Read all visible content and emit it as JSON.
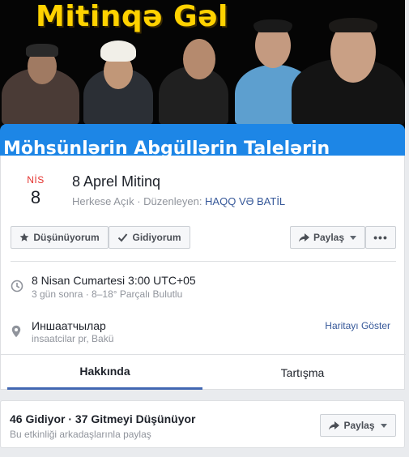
{
  "cover": {
    "title": "Mitinqə Gəl",
    "banner_text": "Möhsünlərin Abgüllərin Talelərin",
    "title_color": "#ffd200",
    "banner_color": "#1d86e6"
  },
  "event": {
    "month": "NİS",
    "day": "8",
    "title": "8 Aprel Mitinq",
    "privacy": "Herkese Açık",
    "separator": " · ",
    "host_prefix": "Düzenleyen: ",
    "host": "HAQQ VƏ BATİL"
  },
  "actions": {
    "interested": "Düşünüyorum",
    "going": "Gidiyorum",
    "share": "Paylaş",
    "more": "•••",
    "icons": [
      "star-icon",
      "check-icon",
      "share-arrow-icon",
      "chevron-down-icon"
    ]
  },
  "details": {
    "time_main": "8 Nisan Cumartesi 3:00 UTC+05",
    "time_sub": "3 gün sonra · 8–18° Parçalı Bulutlu",
    "place_main": "Иншаатчылар",
    "place_sub": "insaatcilar pr, Bakü",
    "map_link": "Haritayı Göster",
    "icons": [
      "clock-icon",
      "location-pin-icon"
    ]
  },
  "tabs": {
    "about": "Hakkında",
    "discussion": "Tartışma",
    "active_color": "#4267b2"
  },
  "stats": {
    "summary": "46 Gidiyor · 37 Gitmeyi Düşünüyor",
    "invite": "Bu etkinliği arkadaşlarınla paylaş",
    "share": "Paylaş"
  },
  "colors": {
    "link": "#365899",
    "date_red": "#e4332f",
    "muted": "#90949c"
  }
}
